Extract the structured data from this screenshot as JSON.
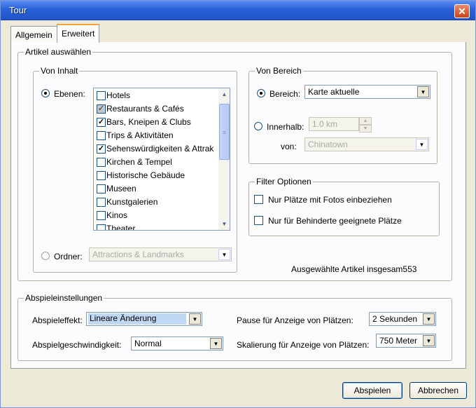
{
  "window": {
    "title": "Tour",
    "close_glyph": "✕"
  },
  "tabs": [
    {
      "label": "Allgemein",
      "active": false
    },
    {
      "label": "Erweitert",
      "active": true
    }
  ],
  "artikel": {
    "legend": "Artikel auswählen",
    "von_inhalt": {
      "legend": "Von Inhalt",
      "ebenen_label": "Ebenen:",
      "ebenen_selected": true,
      "layers": [
        {
          "label": "Hotels",
          "checked": false,
          "grey": false
        },
        {
          "label": "Restaurants & Cafés",
          "checked": true,
          "grey": true
        },
        {
          "label": "Bars, Kneipen & Clubs",
          "checked": true,
          "grey": false
        },
        {
          "label": "Trips & Aktivitäten",
          "checked": false,
          "grey": false
        },
        {
          "label": "Sehenswürdigkeiten & Attrak",
          "checked": true,
          "grey": false
        },
        {
          "label": "Kirchen & Tempel",
          "checked": false,
          "grey": false
        },
        {
          "label": "Historische Gebäude",
          "checked": false,
          "grey": false
        },
        {
          "label": "Museen",
          "checked": false,
          "grey": false
        },
        {
          "label": "Kunstgalerien",
          "checked": false,
          "grey": false
        },
        {
          "label": "Kinos",
          "checked": false,
          "grey": false
        },
        {
          "label": "Theater",
          "checked": false,
          "grey": false
        }
      ],
      "ordner_label": "Ordner:",
      "ordner_value": "Attractions & Landmarks"
    },
    "von_bereich": {
      "legend": "Von Bereich",
      "bereich_label": "Bereich:",
      "bereich_value": "Karte aktuelle",
      "innerhalb_label": "Innerhalb:",
      "innerhalb_value": "1.0 km",
      "von_label": "von:",
      "von_value": "Chinatown"
    },
    "filter": {
      "legend": "Filter Optionen",
      "option1": "Nur Plätze mit Fotos einbeziehen",
      "option2": "Nur für Behinderte geeignete Plätze"
    },
    "summary": "Ausgewählte Artikel insgesam553"
  },
  "playback": {
    "legend": "Abspieleinstellungen",
    "effekt_label": "Abspieleffekt:",
    "effekt_value": "Lineare Änderung",
    "speed_label": "Abspielgeschwindigkeit:",
    "speed_value": "Normal",
    "pause_label": "Pause für Anzeige von Plätzen:",
    "pause_value": "2 Sekunden",
    "scale_label": "Skalierung für Anzeige von Plätzen:",
    "scale_value": "750 Meter"
  },
  "buttons": {
    "play": "Abspielen",
    "cancel": "Abbrechen"
  },
  "colors": {
    "titlebar": "#2a62d8",
    "highlight": "#c1d8f5",
    "tab_accent": "#f1a437"
  }
}
